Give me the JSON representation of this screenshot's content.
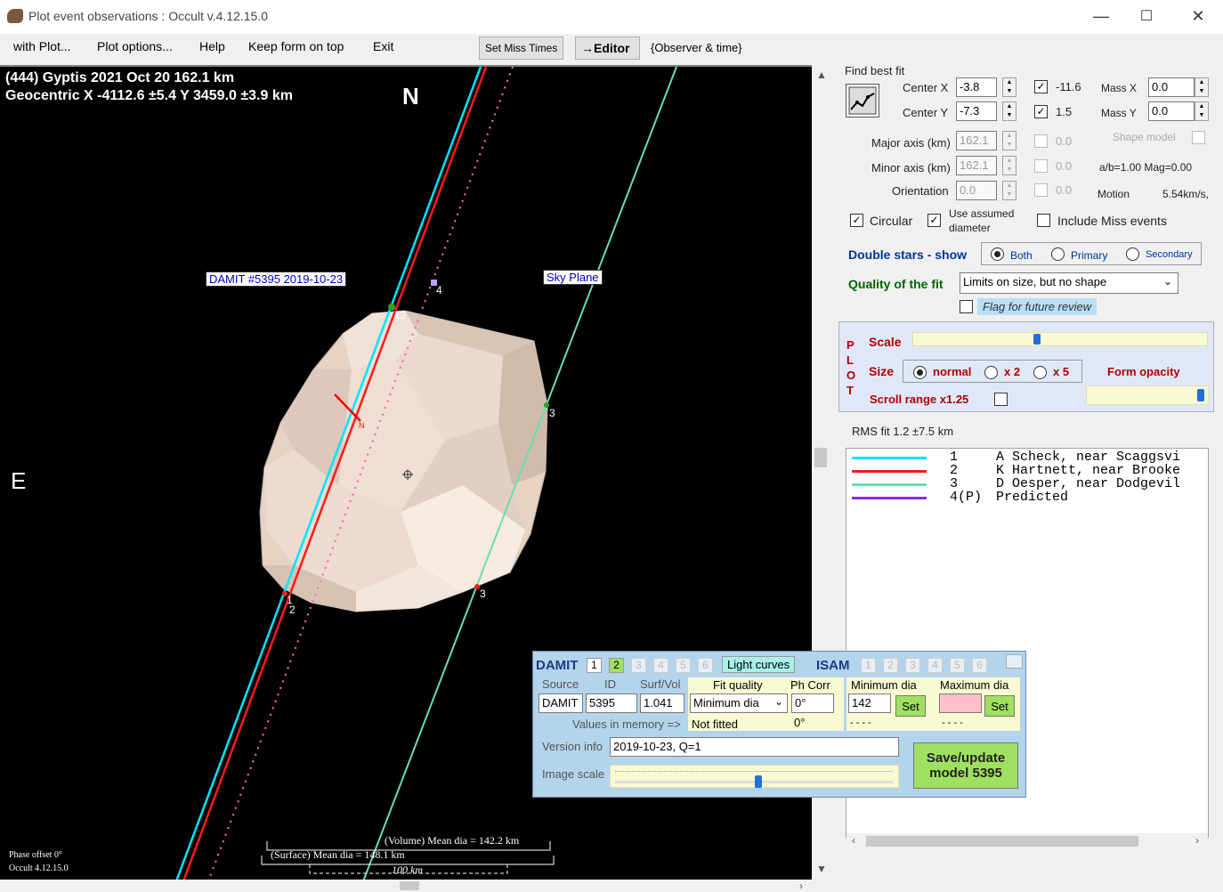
{
  "window": {
    "title": "Plot event observations : Occult v.4.12.15.0"
  },
  "menu": {
    "items": [
      "with Plot...",
      "Plot options...",
      "Help",
      "Keep form on top",
      "Exit"
    ]
  },
  "toolbar": {
    "set_miss_times": "Set Miss Times",
    "editor": "→Editor",
    "observer_time": "{Observer & time}"
  },
  "plot": {
    "header_line1": "(444) Gyptis  2021 Oct 20   162.1 km",
    "header_line2": "Geocentric  X  -4112.6 ±5.4  Y 3459.0 ±3.9 km",
    "north": "N",
    "east": "E",
    "damit_label": "DAMIT #5395 2019-10-23",
    "sky_plane_label": "Sky Plane",
    "chord_labels": {
      "c12": "12",
      "c4": "4",
      "c3a": "3",
      "c3b": "3",
      "c1": "1",
      "c2": "2"
    },
    "pole_label": "N",
    "volume_dia": "(Volume) Mean dia = 142.2 km",
    "surface_dia": "(Surface) Mean dia = 148.1 km",
    "scale_bar": "100 km",
    "phase_offset": "Phase offset 0°",
    "version": "Occult 4.12.15.0",
    "colors": {
      "chord1": "#00e5ff",
      "chord2": "#ff1a1a",
      "chord3": "#66e0b0",
      "predicted": "#ff66aa",
      "shape": "#e8d6c8"
    }
  },
  "fit": {
    "find_best_fit": "Find best fit",
    "center_x_label": "Center X",
    "center_x": "-3.8",
    "center_y_label": "Center Y",
    "center_y": "-7.3",
    "cx_check_val": "-11.6",
    "cy_check_val": "1.5",
    "mass_x_label": "Mass X",
    "mass_x": "0.0",
    "mass_y_label": "Mass Y",
    "mass_y": "0.0",
    "major_axis_label": "Major axis (km)",
    "major_axis": "162.1",
    "minor_axis_label": "Minor axis (km)",
    "minor_axis": "162.1",
    "orientation_label": "Orientation",
    "orientation": "0.0",
    "dis_val1": "0.0",
    "dis_val2": "0.0",
    "dis_val3": "0.0",
    "shape_model_label": "Shape model",
    "ab_mag": "a/b=1.00  Mag=0.00",
    "motion_label": "Motion",
    "motion_value": "5.54km/s,",
    "circular": "Circular",
    "use_assumed": "Use assumed",
    "diameter": "diameter",
    "include_miss": "Include Miss events"
  },
  "double_stars": {
    "label": "Double stars - show",
    "options": [
      "Both",
      "Primary",
      "Secondary"
    ],
    "selected": "Both"
  },
  "quality": {
    "label": "Quality of the fit",
    "value": "Limits on size, but no shape",
    "flag_label": "Flag for future review"
  },
  "plot_panel": {
    "vertical_letters": [
      "P",
      "L",
      "O",
      "T"
    ],
    "scale_label": "Scale",
    "scale_level": 0.42,
    "size_label": "Size",
    "size_options": [
      "normal",
      "x 2",
      "x 5"
    ],
    "form_opacity_label": "Form opacity",
    "opacity_level": 0.97,
    "scroll_range": "Scroll range x1.25"
  },
  "rms": "RMS fit 1.2 ±7.5 km",
  "legend": [
    {
      "num": "1",
      "name": "A Scheck, near Scaggsvi",
      "color": "#00e5ff"
    },
    {
      "num": "2",
      "name": "K Hartnett, near Brooke",
      "color": "#ff1a1a"
    },
    {
      "num": "3",
      "name": "D Oesper, near Dodgevil",
      "color": "#66e0b0"
    },
    {
      "num": "4(P)",
      "name": "Predicted",
      "color": "#8a2be2"
    }
  ],
  "damit": {
    "title": "DAMIT",
    "tabs": [
      "1",
      "2",
      "3",
      "4",
      "5",
      "6"
    ],
    "light_curves": "Light curves",
    "isam": "ISAM",
    "source_label": "Source",
    "id_label": "ID",
    "surfvol_label": "Surf/Vol",
    "source": "DAMIT",
    "id": "5395",
    "surfvol": "1.041",
    "fit_quality_label": "Fit quality",
    "fit_quality": "Minimum dia",
    "ph_corr_label": "Ph Corr",
    "ph_corr": "0°",
    "min_dia_label": "Minimum dia",
    "min_dia": "142",
    "max_dia_label": "Maximum dia",
    "set": "Set",
    "values_in_memory": "Values in memory =>",
    "not_fitted": "Not fitted",
    "ph_mem": "0°",
    "dash1": "- - - -",
    "dash2": "- - - -",
    "version_info_label": "Version info",
    "version_info": "2019-10-23, Q=1",
    "image_scale_label": "Image scale",
    "save_btn_line1": "Save/update",
    "save_btn_line2": "model 5395"
  }
}
